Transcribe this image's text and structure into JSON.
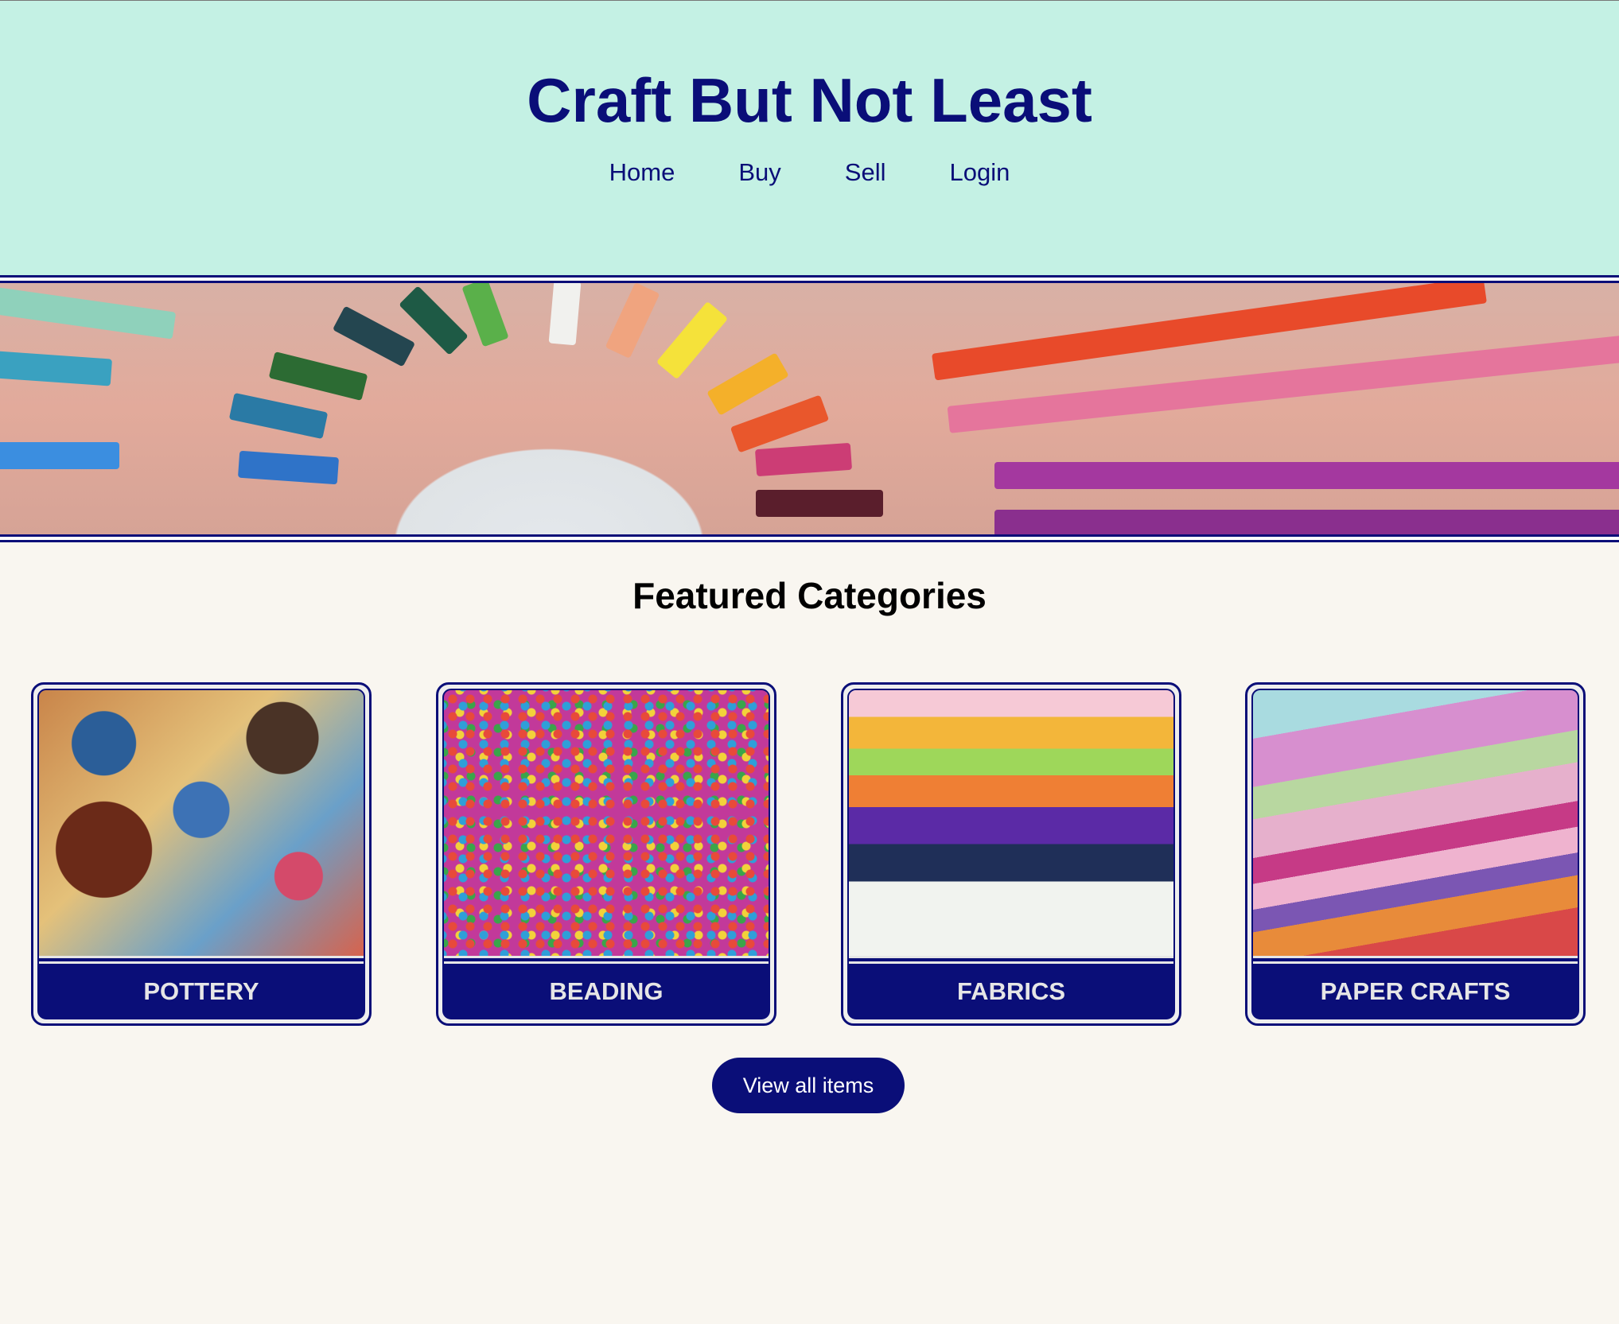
{
  "header": {
    "title": "Craft But Not Least",
    "nav": [
      "Home",
      "Buy",
      "Sell",
      "Login"
    ]
  },
  "main": {
    "heading": "Featured Categories",
    "categories": [
      {
        "label": "POTTERY"
      },
      {
        "label": "BEADING"
      },
      {
        "label": "FABRICS"
      },
      {
        "label": "PAPER CRAFTS"
      }
    ],
    "view_all_label": "View all items"
  },
  "colors": {
    "accent": "#0a0e78",
    "header_bg": "#c4f1e4",
    "page_bg": "#f9f6f0"
  }
}
